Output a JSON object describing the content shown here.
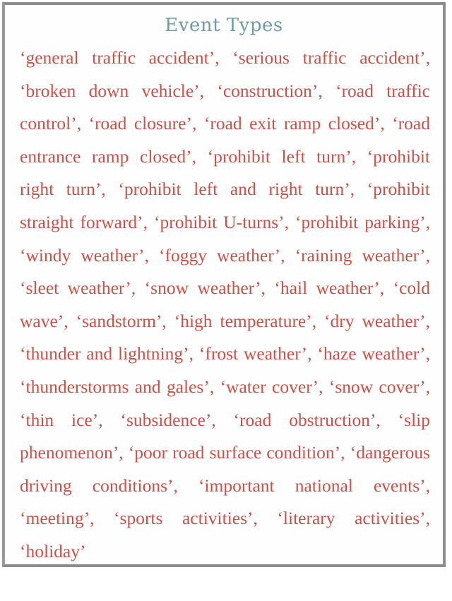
{
  "figure": {
    "title": "Event Types",
    "title_color": "#6d9ea6",
    "body_color": "#cb5148",
    "border_color": "#8d8d8d",
    "background_color": "#ffffff",
    "quote_open": "‘",
    "quote_close": "’",
    "separator": ", "
  },
  "event_types": [
    "general traffic accident",
    "serious traffic accident",
    "broken down vehicle",
    "construction",
    "road traffic control",
    "road closure",
    "road exit ramp closed",
    "road entrance ramp closed",
    "prohibit left turn",
    "prohibit right turn",
    "prohibit left and right turn",
    "prohibit straight forward",
    "prohibit U-turns",
    "prohibit parking",
    "windy weather",
    "foggy weather",
    "raining weather",
    "sleet weather",
    "snow weather",
    "hail weather",
    "cold wave",
    "sandstorm",
    "high temperature",
    "dry weather",
    "thunder and lightning",
    "frost weather",
    "haze weather",
    "thunderstorms and gales",
    "water cover",
    "snow cover",
    "thin ice",
    "subsidence",
    "road obstruction",
    "slip phenomenon",
    "poor road surface condition",
    "dangerous driving conditions",
    "important national events",
    "meeting",
    "sports activities",
    "literary activities",
    "holiday"
  ],
  "event_types_rendered": "‘general traffic accident’, ‘serious traffic accident’, ‘broken down vehicle’, ‘construction’, ‘road traffic control’, ‘road closure’, ‘road exit ramp closed’, ‘road entrance ramp closed’, ‘prohibit left turn’, ‘prohibit right turn’, ‘prohibit left and right turn’, ‘prohibit straight forward’, ‘prohibit U-turns’, ‘prohibit parking’, ‘windy weather’, ‘foggy weather’, ‘raining weather’, ‘sleet weather’, ‘snow weather’, ‘hail weather’, ‘cold wave’, ‘sandstorm’, ‘high temperature’, ‘dry weather’, ‘thunder and lightning’, ‘frost weather’, ‘haze weather’, ‘thunderstorms and gales’, ‘water cover’, ‘snow cover’, ‘thin ice’, ‘subsidence’, ‘road obstruction’, ‘slip phenomenon’, ‘poor road surface condition’, ‘dangerous driving conditions’, ‘important national events’, ‘meeting’, ‘sports activities’, ‘literary activities’, ‘holiday’"
}
